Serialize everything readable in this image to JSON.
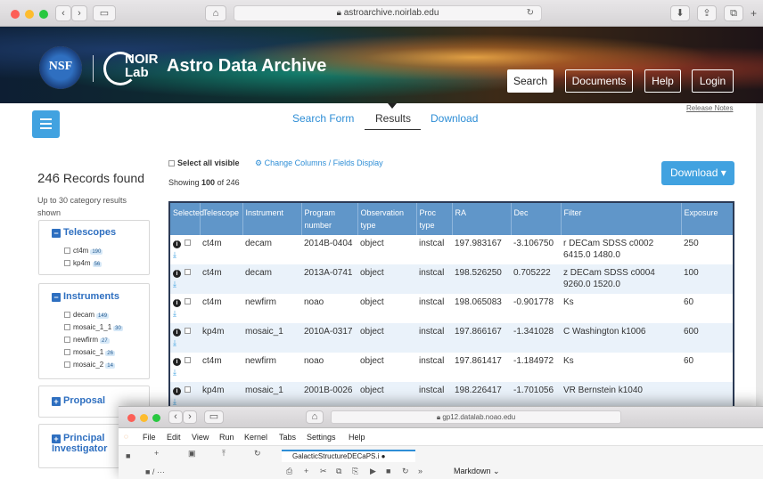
{
  "browser": {
    "url": "astroarchive.noirlab.edu",
    "reload_icon": "↻",
    "nav_back": "‹",
    "nav_forward": "›"
  },
  "header": {
    "nsf_logo_text": "NSF",
    "noir_text_line1": "NOIR",
    "noir_text_line2": "Lab",
    "title": "Astro Data Archive",
    "buttons": {
      "search": "Search",
      "documents": "Documents",
      "help": "Help",
      "login": "Login"
    }
  },
  "tabs": {
    "search_form": "Search Form",
    "results": "Results",
    "download": "Download"
  },
  "release_notes": "Release Notes",
  "sidebar": {
    "records_count": "246",
    "records_label": "Records found",
    "up_to_text": "Up to 30 category results shown",
    "telescopes": {
      "label": "Telescopes",
      "toggle": "−",
      "items": [
        {
          "name": "ct4m",
          "count": "190"
        },
        {
          "name": "kp4m",
          "count": "56"
        }
      ]
    },
    "instruments": {
      "label": "Instruments",
      "toggle": "−",
      "items": [
        {
          "name": "decam",
          "count": "149"
        },
        {
          "name": "mosaic_1_1",
          "count": "30"
        },
        {
          "name": "newfirm",
          "count": "27"
        },
        {
          "name": "mosaic_1",
          "count": "26"
        },
        {
          "name": "mosaic_2",
          "count": "14"
        }
      ]
    },
    "proposal": {
      "label": "Proposal",
      "toggle": "+"
    },
    "principal": {
      "label": "Principal Investigator",
      "toggle": "+"
    }
  },
  "results": {
    "select_all": "Select all visible",
    "change_columns": "Change Columns / Fields Display",
    "gear_icon": "⚙",
    "showing_prefix": "Showing",
    "showing_count": "100",
    "showing_suffix": "of 246",
    "download_button": "Download ▾",
    "columns": [
      "Selected",
      "Telescope",
      "Instrument",
      "Program number",
      "Observation type",
      "Proc type",
      "RA",
      "Dec",
      "Filter",
      "Exposure"
    ],
    "rows": [
      {
        "telescope": "ct4m",
        "instrument": "decam",
        "program": "2014B-0404",
        "obstype": "object",
        "proctype": "instcal",
        "ra": "197.983167",
        "dec": "-3.106750",
        "filter": "r DECam SDSS c0002 6415.0 1480.0",
        "exposure": "250"
      },
      {
        "telescope": "ct4m",
        "instrument": "decam",
        "program": "2013A-0741",
        "obstype": "object",
        "proctype": "instcal",
        "ra": "198.526250",
        "dec": "0.705222",
        "filter": "z DECam SDSS c0004 9260.0 1520.0",
        "exposure": "100"
      },
      {
        "telescope": "ct4m",
        "instrument": "newfirm",
        "program": "noao",
        "obstype": "object",
        "proctype": "instcal",
        "ra": "198.065083",
        "dec": "-0.901778",
        "filter": "Ks",
        "exposure": "60"
      },
      {
        "telescope": "kp4m",
        "instrument": "mosaic_1",
        "program": "2010A-0317",
        "obstype": "object",
        "proctype": "instcal",
        "ra": "197.866167",
        "dec": "-1.341028",
        "filter": "C Washington k1006",
        "exposure": "600"
      },
      {
        "telescope": "ct4m",
        "instrument": "newfirm",
        "program": "noao",
        "obstype": "object",
        "proctype": "instcal",
        "ra": "197.861417",
        "dec": "-1.184972",
        "filter": "Ks",
        "exposure": "60"
      },
      {
        "telescope": "kp4m",
        "instrument": "mosaic_1",
        "program": "2001B-0026",
        "obstype": "object",
        "proctype": "instcal",
        "ra": "198.226417",
        "dec": "-1.701056",
        "filter": "VR Bernstein k1040",
        "exposure": ""
      }
    ]
  },
  "overlay": {
    "url": "gp12.datalab.noao.edu",
    "menu": [
      "File",
      "Edit",
      "View",
      "Run",
      "Kernel",
      "Tabs",
      "Settings",
      "Help"
    ],
    "notebook_tab": "GalacticStructureDECaPS.i ●",
    "path": "■ / ···",
    "cell_type": "Markdown ⌄",
    "toolbar_icons": [
      "+",
      "✂",
      "⧉",
      "⎘",
      "▶",
      "■",
      "↻",
      "»"
    ]
  },
  "colors": {
    "accent": "#41a2e0",
    "table_header": "#6096c9",
    "link": "#2e8ed6",
    "facet_title": "#2e6fc0"
  }
}
